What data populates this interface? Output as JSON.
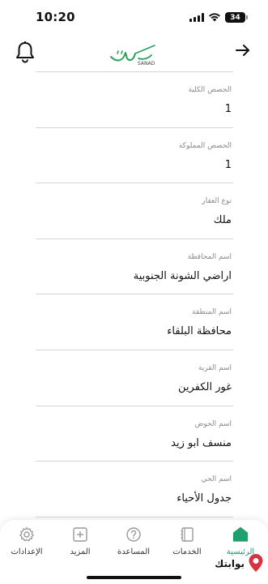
{
  "status_bar": {
    "time": "10:20",
    "battery": "34"
  },
  "header": {
    "logo_text": "SANAD"
  },
  "colors": {
    "accent": "#1f9e6e",
    "label": "#8a8a8a",
    "divider": "#d4d4d4",
    "watermark_red": "#d9313f"
  },
  "fields": [
    {
      "label": "الحصص الكلية",
      "value": "1"
    },
    {
      "label": "الحصص المملوكة",
      "value": "1"
    },
    {
      "label": "نوع العقار",
      "value": "ملك"
    },
    {
      "label": "اسم المحافظة",
      "value": "اراضي الشونة الجنوبية"
    },
    {
      "label": "اسم المنطقة",
      "value": "محافظة البلقاء"
    },
    {
      "label": "اسم القرية",
      "value": "غور الكفرين"
    },
    {
      "label": "اسم الحوض",
      "value": "منسف ابو زيد"
    },
    {
      "label": "اسم الحي",
      "value": "جدول الأحياء"
    }
  ],
  "tab_bar": {
    "settings": "الإعدادات",
    "more": "المزيد",
    "help": "المساعدة",
    "services": "الخدمات",
    "home": "الرئيسية"
  },
  "watermark": {
    "text": "بوابتك"
  },
  "icons": [
    "bell-icon",
    "back-arrow-icon",
    "gear-icon",
    "plus-icon",
    "question-icon",
    "services-icon",
    "home-icon",
    "map-pin-icon"
  ]
}
